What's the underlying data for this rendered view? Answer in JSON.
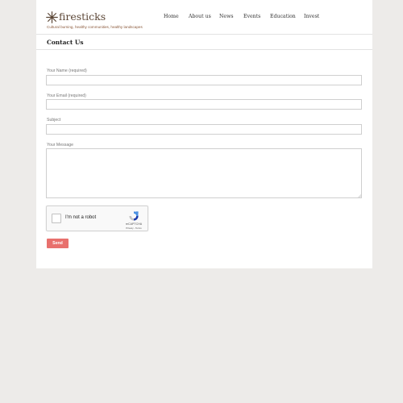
{
  "brand": {
    "name": "firesticks",
    "tagline": "Cultural burning, healthy communities, healthy landscapes"
  },
  "nav": {
    "items": [
      {
        "label": "Home"
      },
      {
        "label": "About us"
      },
      {
        "label": "News"
      },
      {
        "label": "Events"
      },
      {
        "label": "Education"
      },
      {
        "label": "Invest"
      }
    ]
  },
  "page": {
    "title": "Contact Us"
  },
  "form": {
    "name_label": "Your Name (required)",
    "name_value": "",
    "email_label": "Your Email (required)",
    "email_value": "",
    "subject_label": "Subject",
    "subject_value": "",
    "message_label": "Your Message",
    "message_value": "",
    "submit_label": "Send"
  },
  "recaptcha": {
    "label": "I'm not a robot",
    "brand": "reCAPTCHA",
    "privacy": "Privacy",
    "separator": " - ",
    "terms": "Terms"
  },
  "colors": {
    "page_background": "#edebe9",
    "brand_text": "#5b4636",
    "tagline_text": "#8b5a3c",
    "send_button": "#e8706d"
  }
}
